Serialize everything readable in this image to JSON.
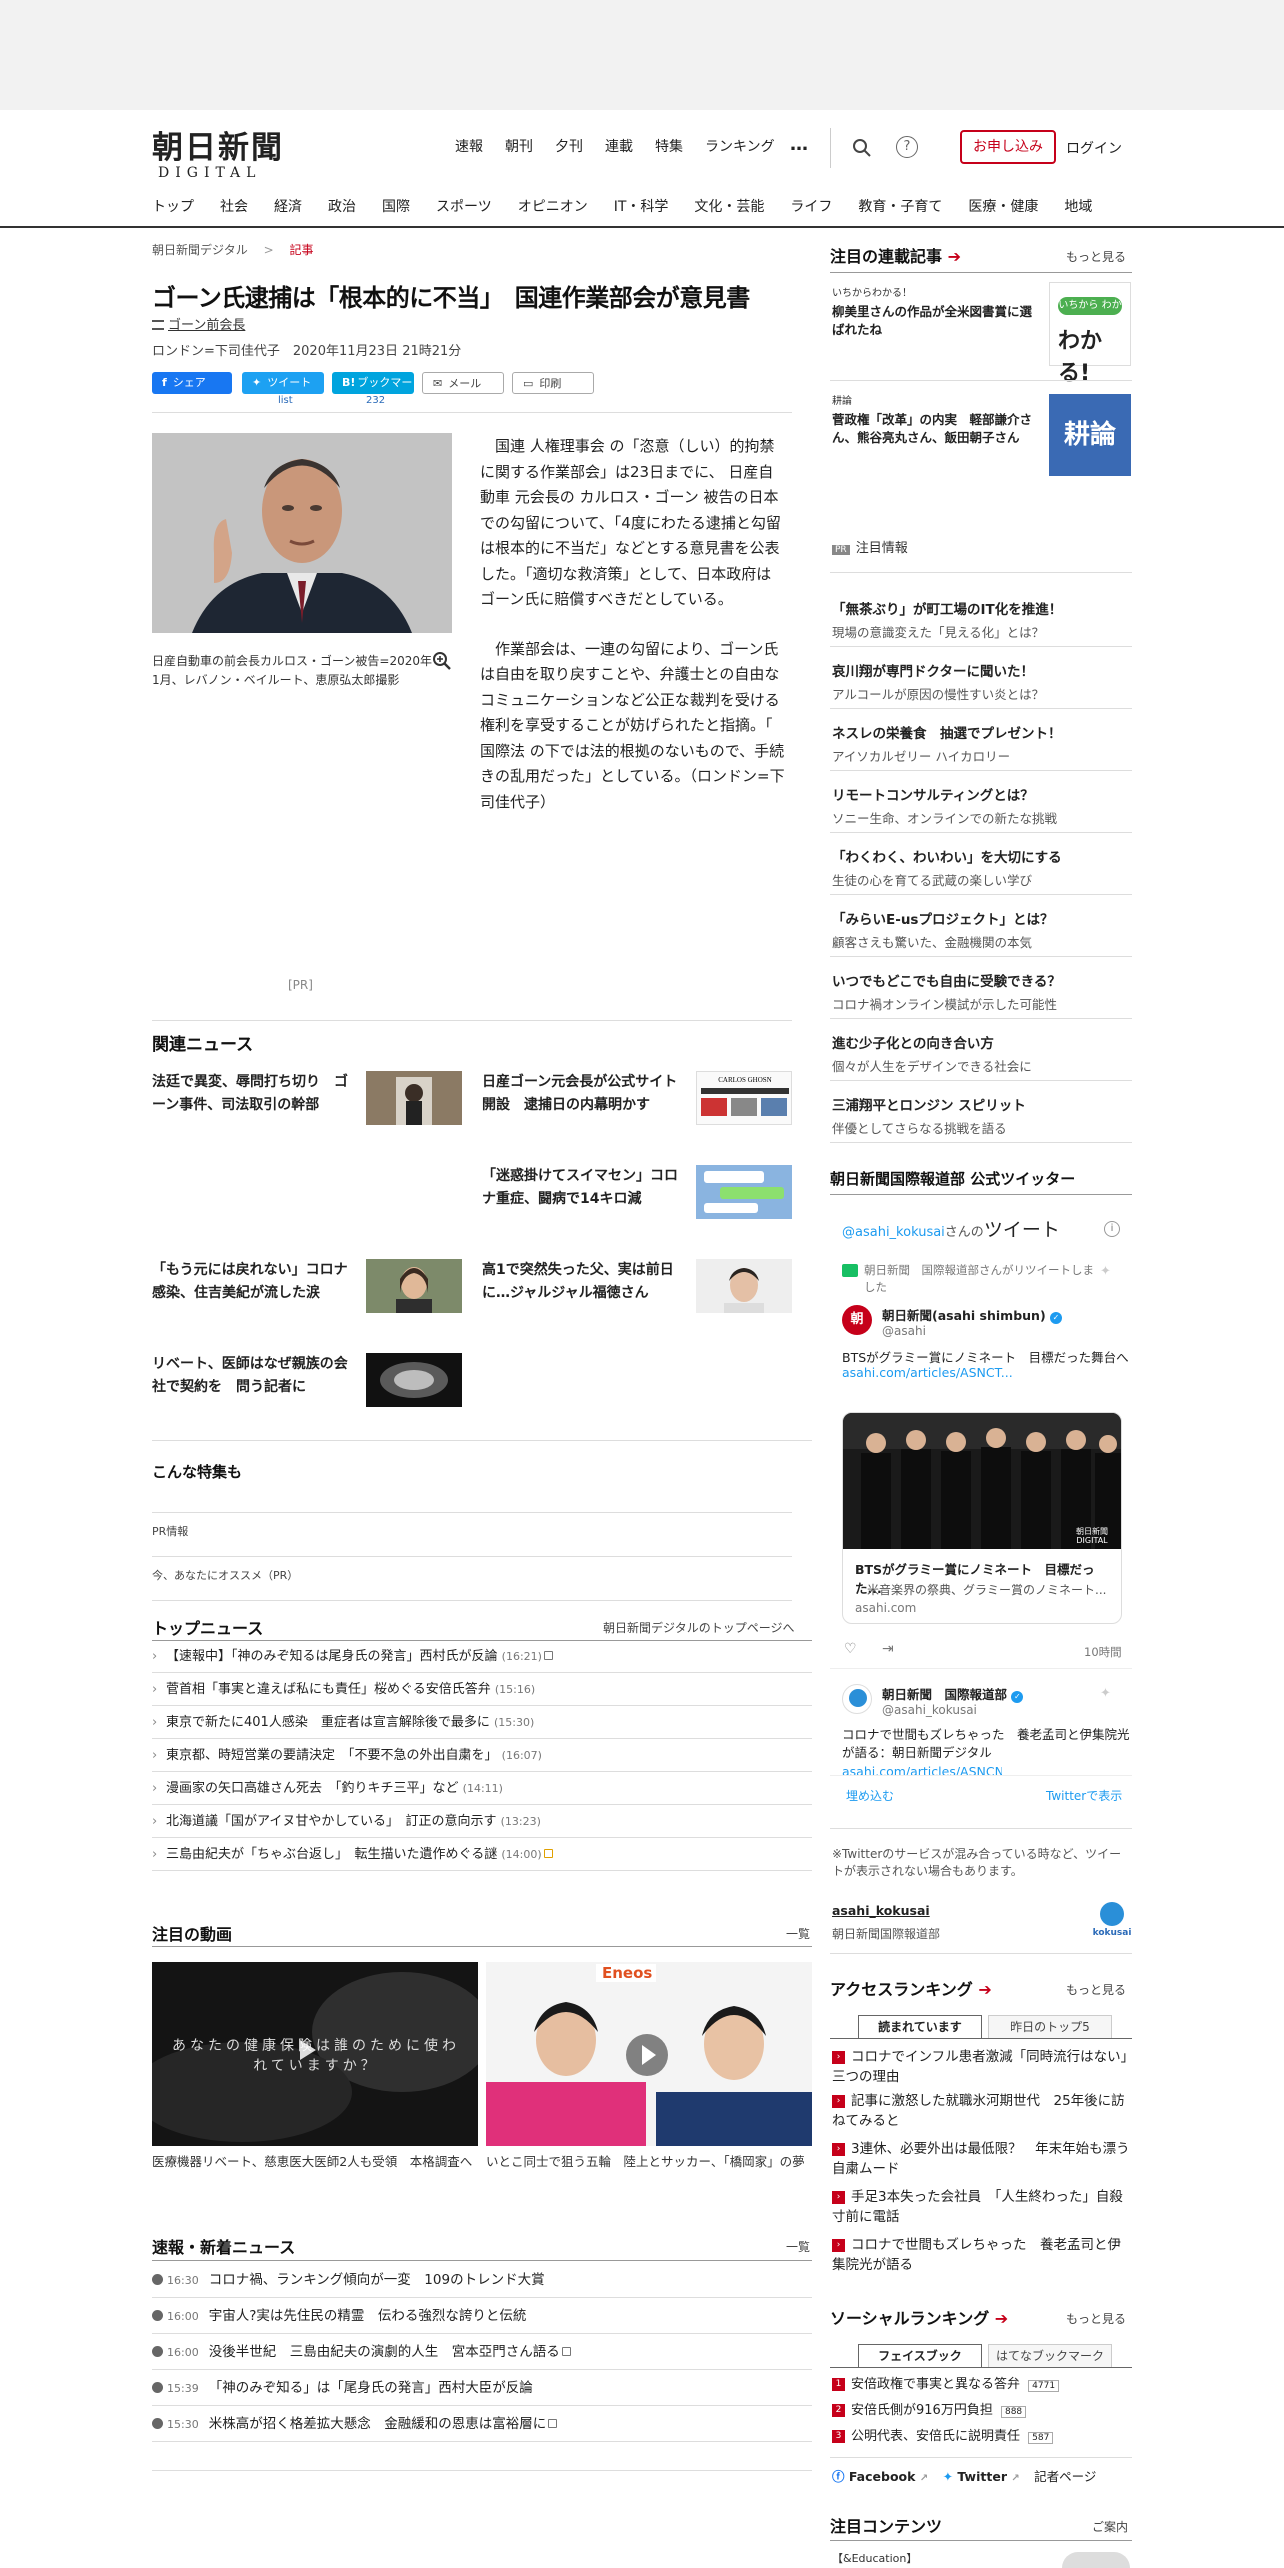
{
  "header": {
    "logo_jp": "朝日新聞",
    "logo_en": "DIGITAL",
    "topnav": [
      "速報",
      "朝刊",
      "夕刊",
      "連載",
      "特集",
      "ランキング"
    ],
    "more_label": "…",
    "subscribe": "お申し込み",
    "login": "ログイン",
    "help": "?",
    "catnav": [
      "トップ",
      "社会",
      "経済",
      "政治",
      "国際",
      "スポーツ",
      "オピニオン",
      "IT・科学",
      "文化・芸能",
      "ライフ",
      "教育・子育て",
      "医療・健康",
      "地域"
    ]
  },
  "breadcrumb": {
    "home": "朝日新聞デジタル",
    "sep": ">",
    "current": "記事"
  },
  "article": {
    "title": "ゴーン氏逮捕は「根本的に不当」　国連作業部会が意見書",
    "tag": "ゴーン前会長",
    "byline": "ロンドン=下司佳代子　2020年11月23日 21時21分",
    "share": {
      "facebook": "シェア",
      "twitter": "ツイート",
      "twitter_count": "list",
      "hatena": "ブックマーク",
      "hatena_count": "232",
      "mail": "メール",
      "print": "印刷"
    },
    "caption": "日産自動車の前会長カルロス・ゴーン被告=2020年1月、レバノン・ベイルート、恵原弘太郎撮影",
    "para1": "国連 人権理事会 の「恣意（しい）的拘禁に関する作業部会」は23日までに、 日産自動車 元会長の カルロス・ゴーン 被告の日本での勾留について、「4度にわたる逮捕と勾留は根本的に不当だ」などとする意見書を公表した。「適切な救済策」として、日本政府はゴーン氏に賠償すべきだとしている。",
    "para2": "作業部会は、一連の勾留により、ゴーン氏は自由を取り戻すことや、弁護士との自由なコミュニケーションなど公正な裁判を受ける権利を享受することが妨げられたと指摘。「 国際法 の下では法的根拠のないもので、手続きの乱用だった」としている。（ロンドン=下司佳代子）",
    "pr": "[PR]"
  },
  "related": {
    "heading": "関連ニュース",
    "items": [
      "法廷で異変、辱問打ち切り　ゴーン事件、司法取引の幹部",
      "日産ゴーン元会長が公式サイト開設　逮捕日の内幕明かす",
      "「迷惑掛けてスイマセン」コロナ重症、闘病で14キロ減",
      "「もう元には戻れない」コロナ感染、住吉美紀が流した涙",
      "高1で突然失った父、実は前日に…ジャルジャル福徳さん",
      "リベート、医師はなぜ親族の会社で契約を　問う記者に"
    ],
    "img_text": "CARLOS GHOSN"
  },
  "features": {
    "heading": "こんな特集も",
    "pr_info": "PR情報",
    "recommend": "今、あなたにオススメ（PR）"
  },
  "topnews": {
    "heading": "トップニュース",
    "more": "朝日新聞デジタルのトップページへ",
    "items": [
      {
        "t": "【速報中】「神のみぞ知るは尾身氏の発言」西村氏が反論",
        "time": "(16:21)"
      },
      {
        "t": "菅首相「事実と違えば私にも責任」桜めぐる安倍氏答弁",
        "time": "(15:16)"
      },
      {
        "t": "東京で新たに401人感染　重症者は宣言解除後で最多に",
        "time": "(15:30)"
      },
      {
        "t": "東京都、時短営業の要請決定　「不要不急の外出自粛を」",
        "time": "(16:07)"
      },
      {
        "t": "漫画家の矢口高雄さん死去　「釣りキチ三平」など",
        "time": "(14:11)"
      },
      {
        "t": "北海道議「国がアイヌ甘やかしている」　訂正の意向示す",
        "time": "(13:23)"
      },
      {
        "t": "三島由紀夫が「ちゃぶ台返し」　転生描いた遺作めぐる謎",
        "time": "(14:00)"
      }
    ]
  },
  "videos": {
    "heading": "注目の動画",
    "more": "一覧",
    "v1_overlay": "あなたの健康保険は誰のために使われていますか？",
    "v1_caption": "医療機器リベート、慈恵医大医師2人も受領　本格調査へ",
    "v2_caption": "いとこ同士で狙う五輪　陸上とサッカー、「橋岡家」の夢",
    "v2_label": "Eneos"
  },
  "breaking": {
    "heading": "速報・新着ニュース",
    "more": "一覧",
    "items": [
      {
        "time": "16:30",
        "t": "コロナ禍、ランキング傾向が一変　109のトレンド大賞"
      },
      {
        "time": "16:00",
        "t": "宇宙人?実は先住民の精霊　伝わる強烈な誇りと伝統"
      },
      {
        "time": "16:00",
        "t": "没後半世紀　三島由紀夫の演劇的人生　宮本亞門さん語る"
      },
      {
        "time": "15:39",
        "t": "「神のみぞ知る」は「尾身氏の発言」西村大臣が反論"
      },
      {
        "time": "15:30",
        "t": "米株高が招く格差拡大懸念　金融緩和の恩恵は富裕層に"
      }
    ]
  },
  "sidebar": {
    "series_heading": "注目の連載記事",
    "more": "もっと見る",
    "series": [
      {
        "label": "いちからわかる！",
        "title": "柳美里さんの作品が全米図書賞に選ばれたね",
        "img": "いちから わかる!"
      },
      {
        "label": "耕論",
        "title": "菅政権「改革」の内実　軽部謙介さん、熊谷亮丸さん、飯田朝子さん",
        "img": "耕論"
      }
    ],
    "pr_badge": "PR",
    "pr_heading": "注目情報",
    "pr_items": [
      {
        "t": "「無茶ぶり」が町工場のIT化を推進！",
        "s": "現場の意識変えた「見える化」とは？"
      },
      {
        "t": "哀川翔が専門ドクターに聞いた！",
        "s": "アルコールが原因の慢性すい炎とは？"
      },
      {
        "t": "ネスレの栄養食　抽選でプレゼント！",
        "s": "アイソカルゼリー ハイカロリー"
      },
      {
        "t": "リモートコンサルティングとは？",
        "s": "ソニー生命、オンラインでの新たな挑戦"
      },
      {
        "t": "「わくわく、わいわい」を大切にする",
        "s": "生徒の心を育てる武蔵の楽しい学び"
      },
      {
        "t": "「みらいE-usプロジェクト」とは？",
        "s": "顧客さえも驚いた、金融機関の本気"
      },
      {
        "t": "いつでもどこでも自由に受験できる？",
        "s": "コロナ禍オンライン模試が示した可能性"
      },
      {
        "t": "進む少子化との向き合い方",
        "s": "個々が人生をデザインできる社会に"
      },
      {
        "t": "三浦翔平とロンジン スピリット",
        "s": "伴優としてさらなる挑戦を語る"
      }
    ],
    "twitter": {
      "heading": "朝日新聞国際報道部 公式ツイッター",
      "handle_line": "@asahi_kokusai",
      "handle_suffix": "さんの",
      "tweet_word": "ツイート",
      "rt_note": "朝日新聞　国際報道部さんがリツイートしました",
      "name1": "朝日新聞(asahi shimbun)",
      "at1": "@asahi",
      "text1": "BTSがグラミー賞にノミネート　目標だった舞台へ",
      "link1": "asahi.com/articles/ASNCT...",
      "card_title": "BTSがグラミー賞にノミネート　目標だった...",
      "card_desc": "米音楽界の祭典、グラミー賞のノミネート...",
      "card_domain": "asahi.com",
      "card_watermark": "朝日新聞 DIGITAL",
      "time": "10時間",
      "name2": "朝日新聞　国際報道部",
      "at2": "@asahi_kokusai",
      "text2": "コロナで世間もズレちゃった　養老孟司と伊集院光が語る：朝日新聞デジタル",
      "link2": "asahi.com/articles/ASNCN...",
      "embed": "埋め込む",
      "view": "Twitterで表示",
      "note": "※Twitterのサービスが混み合っている時など、ツイートが表示されない場合もあります。",
      "account": "asahi_kokusai",
      "account_desc": "朝日新聞国際報道部",
      "kokusai_logo": "kokusai"
    },
    "access_heading": "アクセスランキング",
    "access_tabs": [
      "読まれています",
      "昨日のトップ5"
    ],
    "access_items": [
      "コロナでインフル患者激減「同時流行はない」三つの理由",
      "記事に激怒した就職氷河期世代　25年後に訪ねてみると",
      "3連休、必要外出は最低限？　年末年始も漂う自粛ムード",
      "手足3本失った会社員　「人生終わった」自殺寸前に電話",
      "コロナで世間もズレちゃった　養老孟司と伊集院光が語る"
    ],
    "social_heading": "ソーシャルランキング",
    "social_tabs": [
      "フェイスブック",
      "はてなブックマーク"
    ],
    "social_items": [
      {
        "n": "1",
        "t": "安倍政権で事実と異なる答弁",
        "c": "4771"
      },
      {
        "n": "2",
        "t": "安倍氏側が916万円負担",
        "c": "888"
      },
      {
        "n": "3",
        "t": "公明代表、安倍氏に説明責任",
        "c": "587"
      }
    ],
    "social_links": [
      "Facebook",
      "Twitter",
      "記者ページ"
    ],
    "contents_heading": "注目コンテンツ",
    "contents_more": "ご案内",
    "contents_first": "【&Education】"
  }
}
